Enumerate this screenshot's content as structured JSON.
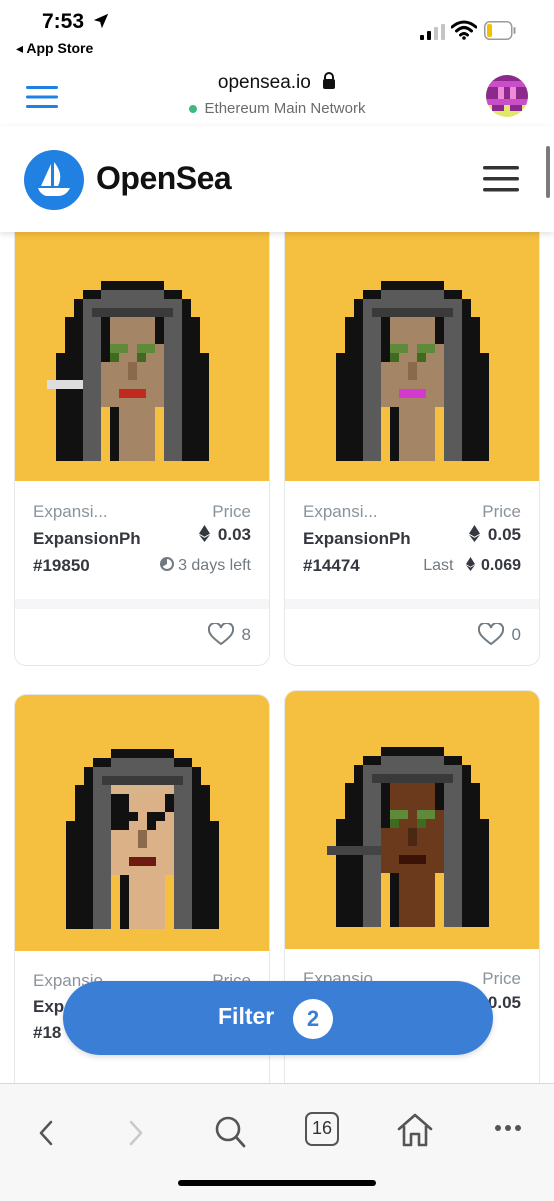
{
  "status_bar": {
    "time": "7:53",
    "back_label": "◂ App Store"
  },
  "browser": {
    "url": "opensea.io",
    "network": "Ethereum Main Network",
    "tab_count": "16"
  },
  "app": {
    "brand": "OpenSea"
  },
  "cards": [
    {
      "collection": "Expansi...",
      "name": "ExpansionPh",
      "token": "#19850",
      "price_label": "Price",
      "price": "0.03",
      "sub_text": "3 days left",
      "likes": "8",
      "skin": "#a48565",
      "lips": "#c12a1e"
    },
    {
      "collection": "Expansi...",
      "name": "ExpansionPh",
      "token": "#14474",
      "price_label": "Price",
      "price": "0.05",
      "sub_label": "Last",
      "sub_value": "0.069",
      "likes": "0",
      "skin": "#a48565",
      "lips": "#d53ad0"
    },
    {
      "collection": "Expansio",
      "name": "Exp",
      "token": "#18",
      "price_label": "Price",
      "skin": "#dbb288",
      "lips": "#6e1a12"
    },
    {
      "collection": "Expansio",
      "price_label": "Price",
      "price": "0.05",
      "skin": "#6b3a1c",
      "lips": "#3a1208"
    }
  ],
  "filter": {
    "label": "Filter",
    "count": "2"
  },
  "colors": {
    "accent": "#3b7ed6",
    "brand_blue": "#2081e2",
    "card_bg": "#f5bf3f"
  },
  "icons": [
    "location-arrow-icon",
    "signal-icon",
    "wifi-icon",
    "battery-icon",
    "menu-icon",
    "lock-icon",
    "ethereum-icon",
    "clock-icon",
    "heart-icon",
    "back-icon",
    "forward-icon",
    "search-icon",
    "tabs-icon",
    "home-icon",
    "more-icon"
  ]
}
